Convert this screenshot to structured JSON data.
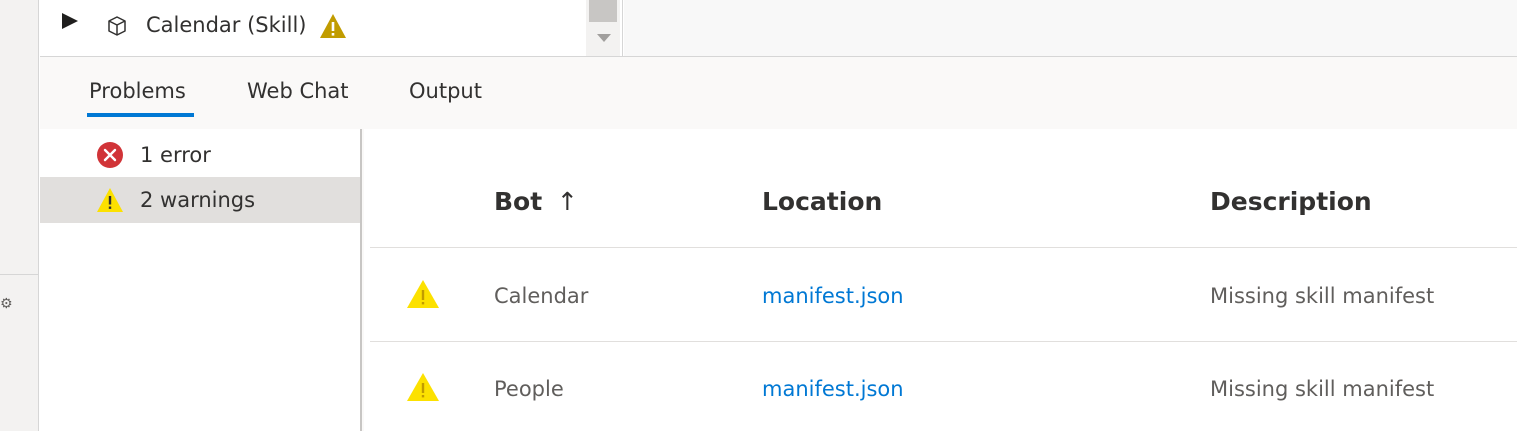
{
  "tree": {
    "item_label": "Calendar (Skill)"
  },
  "tabs": [
    {
      "label": "Problems",
      "active": true
    },
    {
      "label": "Web Chat",
      "active": false
    },
    {
      "label": "Output",
      "active": false
    }
  ],
  "filters": [
    {
      "label": "1 error",
      "type": "error",
      "selected": false
    },
    {
      "label": "2 warnings",
      "type": "warning",
      "selected": true
    }
  ],
  "table": {
    "columns": {
      "bot": "Bot",
      "sort_indicator": "↑",
      "location": "Location",
      "description": "Description"
    },
    "rows": [
      {
        "severity": "warning",
        "bot": "Calendar",
        "location": "manifest.json",
        "description": "Missing skill manifest"
      },
      {
        "severity": "warning",
        "bot": "People",
        "location": "manifest.json",
        "description": "Missing skill manifest"
      }
    ]
  },
  "colors": {
    "accent": "#0078d4",
    "error": "#d13438",
    "warning_yellow": "#fce100",
    "warning_amber": "#c19c00"
  },
  "icons": {
    "expand": "caret-right-icon",
    "bot_type": "cube-icon",
    "tree_warning": "warning-icon",
    "error_filter": "error-circle-icon",
    "warning_filter": "warning-icon",
    "side_rail": "gear-icon"
  }
}
